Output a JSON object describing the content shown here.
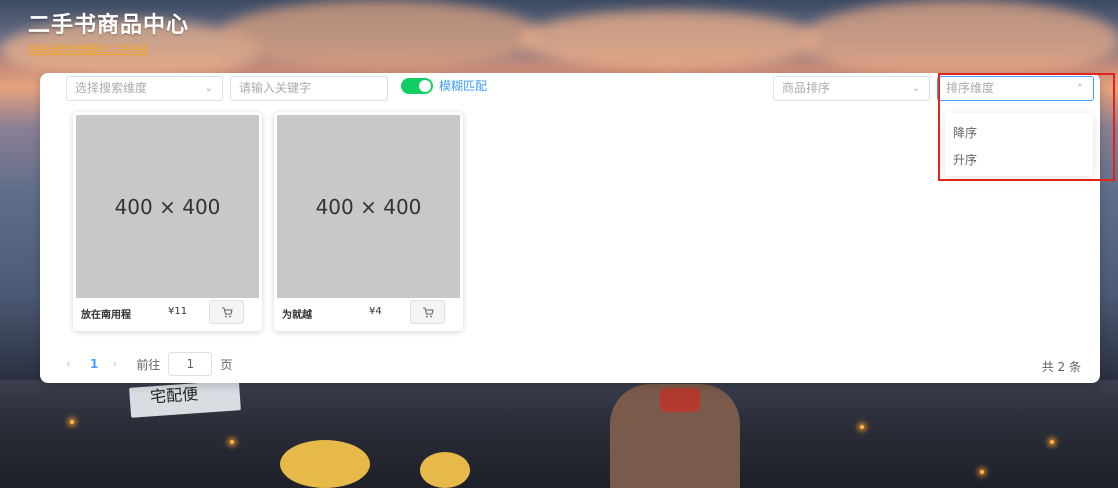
{
  "header": {
    "title": "二手书商品中心",
    "subtitle": "快来选购你想要的二手书吧"
  },
  "search": {
    "dimension_placeholder": "选择搜索维度",
    "keyword_placeholder": "请输入关键字",
    "fuzzy_label": "模糊匹配",
    "fuzzy_enabled": true,
    "sort_placeholder": "商品排序",
    "sort_dim_placeholder": "排序维度"
  },
  "dropdown": {
    "options": [
      "降序",
      "升序"
    ]
  },
  "products": [
    {
      "image_text": "400 × 400",
      "name": "放在南用程",
      "price": "¥11"
    },
    {
      "image_text": "400 × 400",
      "name": "为就越",
      "price": "¥4"
    }
  ],
  "pagination": {
    "prev": "‹",
    "current": "1",
    "next": "›",
    "goto_label": "前往",
    "goto_value": "1",
    "page_unit": "页",
    "total_text": "共 2 条"
  },
  "scene": {
    "sign_text": "宅配便"
  },
  "colors": {
    "accent": "#409eff",
    "switch_on": "#13ce66",
    "highlight_box": "#e0231b",
    "subtitle": "#f5a623"
  },
  "icons": {
    "select_arrow": "chevron-down-icon",
    "open_arrow": "chevron-up-icon",
    "cart": "cart-icon"
  }
}
